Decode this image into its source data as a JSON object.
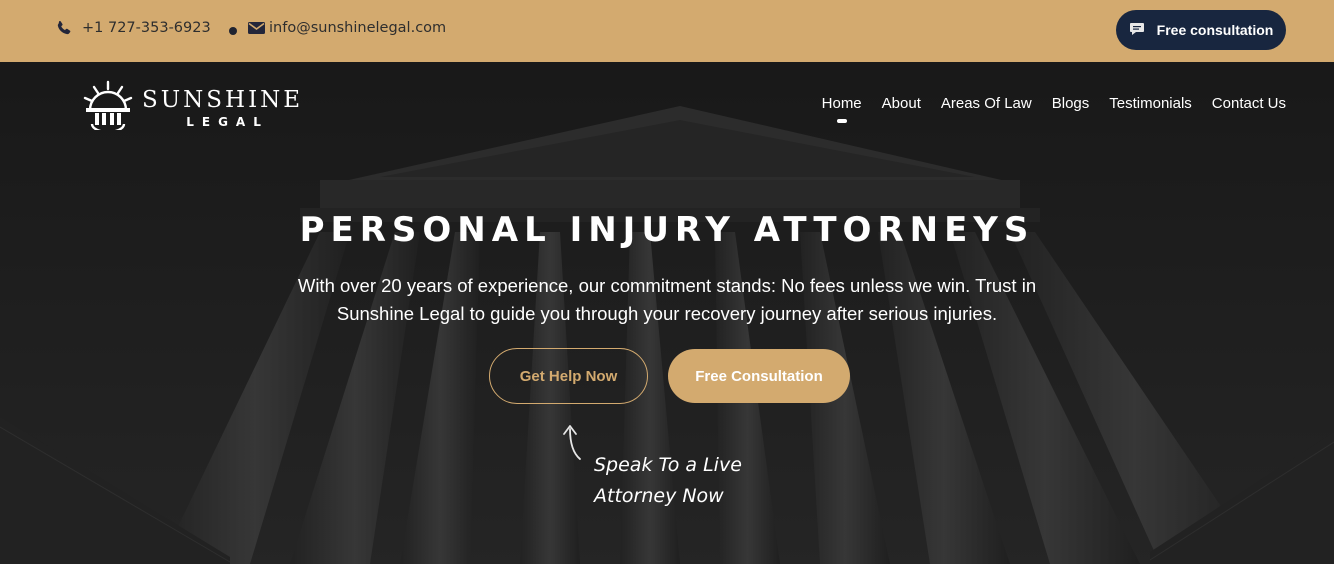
{
  "topbar": {
    "phone": "+1 727-353-6923",
    "email": "info@sunshinelegal.com",
    "cta_label": "Free consultation",
    "icons": [
      "phone-icon",
      "mail-icon",
      "chat-icon"
    ],
    "background_color": "#d3aa6f",
    "cta_color": "#18263f"
  },
  "logo": {
    "line1": "SUNSHINE",
    "line2": "LEGAL"
  },
  "nav": {
    "items": [
      {
        "label": "Home"
      },
      {
        "label": "About"
      },
      {
        "label": "Areas Of Law"
      },
      {
        "label": "Blogs"
      },
      {
        "label": "Testimonials"
      },
      {
        "label": "Contact Us"
      }
    ],
    "active": "Home"
  },
  "hero": {
    "headline": "PERSONAL INJURY ATTORNEYS",
    "subtext": "With over 20 years of experience, our commitment stands: No fees unless we win. Trust in Sunshine Legal to guide you through your recovery journey after serious injuries.",
    "primary_button": "Get Help Now",
    "secondary_button": "Free Consultation",
    "note_line1": "Speak To a Live",
    "note_line2": "Attorney Now",
    "accent_color": "#d3aa6f"
  }
}
